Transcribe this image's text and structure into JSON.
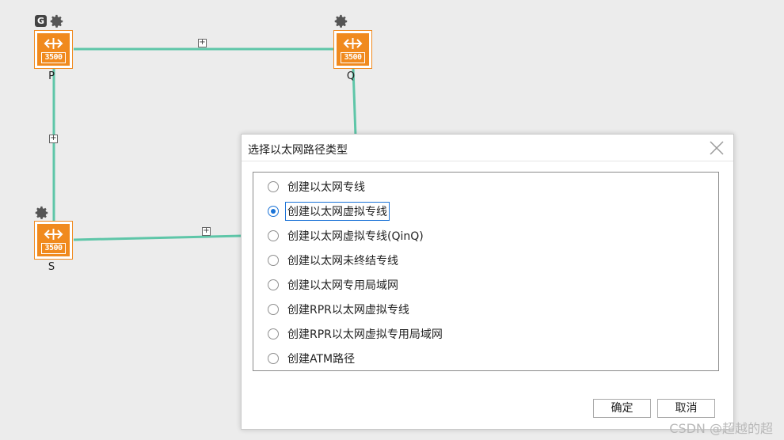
{
  "topology": {
    "nodes": [
      {
        "id": "P",
        "label": "P",
        "model": "3500",
        "badge": "G"
      },
      {
        "id": "Q",
        "label": "Q",
        "model": "3500"
      },
      {
        "id": "S",
        "label": "S",
        "model": "3500"
      }
    ],
    "link_marker": "+"
  },
  "dialog": {
    "title": "选择以太网路径类型",
    "options": [
      {
        "label": "创建以太网专线",
        "checked": false
      },
      {
        "label": "创建以太网虚拟专线",
        "checked": true
      },
      {
        "label": "创建以太网虚拟专线(QinQ)",
        "checked": false
      },
      {
        "label": "创建以太网未终结专线",
        "checked": false
      },
      {
        "label": "创建以太网专用局域网",
        "checked": false
      },
      {
        "label": "创建RPR以太网虚拟专线",
        "checked": false
      },
      {
        "label": "创建RPR以太网虚拟专用局域网",
        "checked": false
      },
      {
        "label": "创建ATM路径",
        "checked": false
      }
    ],
    "ok_label": "确定",
    "cancel_label": "取消"
  },
  "watermark": "CSDN @超越的超",
  "colors": {
    "link": "#5ec6a8",
    "device": "#f08a1e",
    "accent": "#1b73d7"
  }
}
